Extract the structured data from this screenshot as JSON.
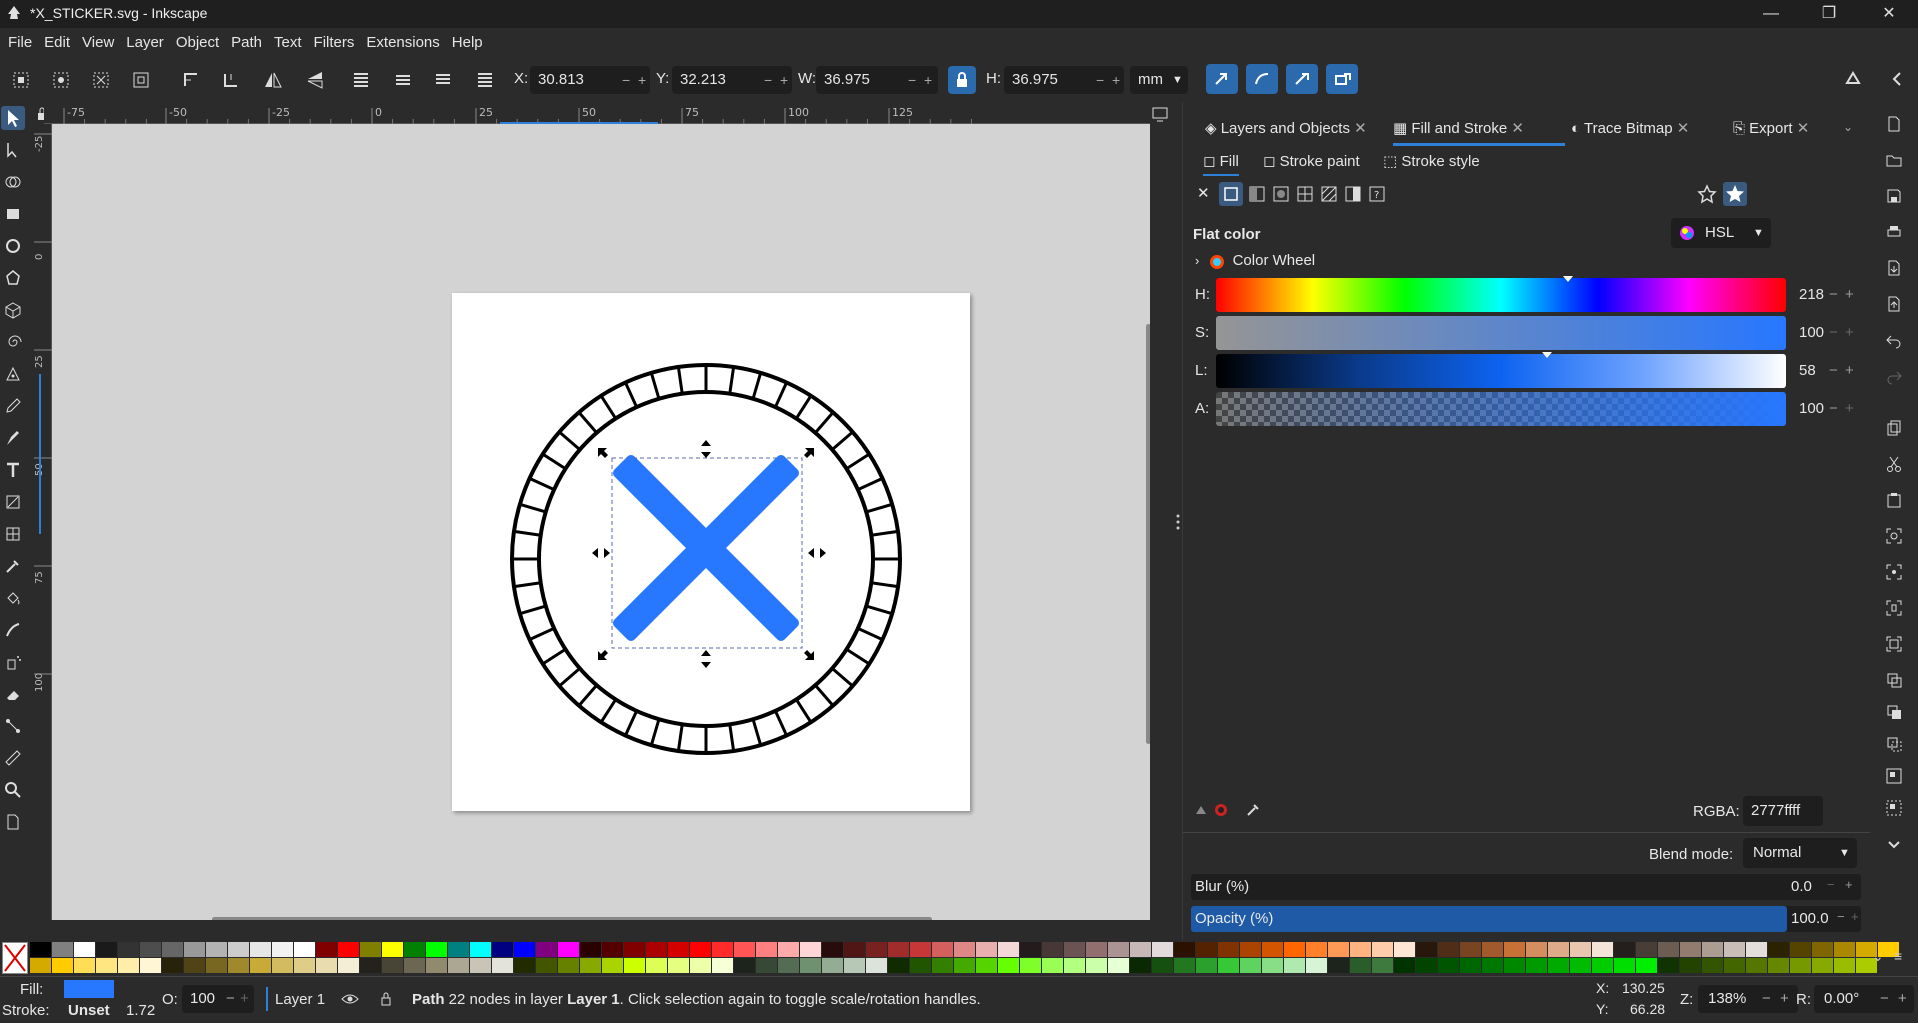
{
  "window": {
    "title": "*X_STICKER.svg - Inkscape",
    "controls": [
      "—",
      "❐",
      "✕"
    ]
  },
  "menu": [
    "File",
    "Edit",
    "View",
    "Layer",
    "Object",
    "Path",
    "Text",
    "Filters",
    "Extensions",
    "Help"
  ],
  "toolbar": {
    "x_label": "X:",
    "x_value": "30.813",
    "y_label": "Y:",
    "y_value": "32.213",
    "w_label": "W:",
    "w_value": "36.975",
    "h_label": "H:",
    "h_value": "36.975",
    "unit": "mm",
    "minus": "−",
    "plus": "+"
  },
  "rulers": {
    "h_ticks": [
      "-75",
      "-50",
      "-25",
      "0",
      "25",
      "50",
      "75",
      "100",
      "125"
    ],
    "v_ticks": [
      "-25",
      "0",
      "25",
      "50",
      "75",
      "100"
    ]
  },
  "dialog": {
    "tabs": [
      "Layers and Objects",
      "Fill and Stroke",
      "Trace Bitmap",
      "Export"
    ],
    "active_tab": "Fill and Stroke",
    "subtabs": [
      "Fill",
      "Stroke paint",
      "Stroke style"
    ],
    "active_subtab": "Fill",
    "flat_color_label": "Flat color",
    "color_mode": "HSL",
    "color_wheel_label": "Color Wheel",
    "sliders": [
      {
        "label": "H:",
        "value": "218"
      },
      {
        "label": "S:",
        "value": "100"
      },
      {
        "label": "L:",
        "value": "58"
      },
      {
        "label": "A:",
        "value": "100"
      }
    ],
    "rgba_label": "RGBA:",
    "rgba_value": "2777ffff",
    "blend_label": "Blend mode:",
    "blend_value": "Normal",
    "blur_label": "Blur (%)",
    "blur_value": "0.0",
    "opacity_label": "Opacity (%)",
    "opacity_value": "100.0"
  },
  "status": {
    "fill_label": "Fill:",
    "stroke_label": "Stroke:",
    "stroke_value": "Unset",
    "stroke_width": "1.72",
    "opacity_label": "O:",
    "opacity_value": "100",
    "layer_name": "Layer 1",
    "message_prefix": "Path",
    "message_body": " 22 nodes in layer ",
    "message_layer": "Layer 1",
    "message_tail": ". Click selection again to toggle scale/rotation handles.",
    "cursor_x_label": "X:",
    "cursor_x": "130.25",
    "cursor_y_label": "Y:",
    "cursor_y": "66.28",
    "zoom_label": "Z:",
    "zoom": "138%",
    "rotate_label": "R:",
    "rotate": "0.00°"
  },
  "colors": {
    "fill": "#2777ff",
    "accent": "#2f80d8",
    "background": "#2b2b2b",
    "canvas": "#d3d3d3"
  }
}
